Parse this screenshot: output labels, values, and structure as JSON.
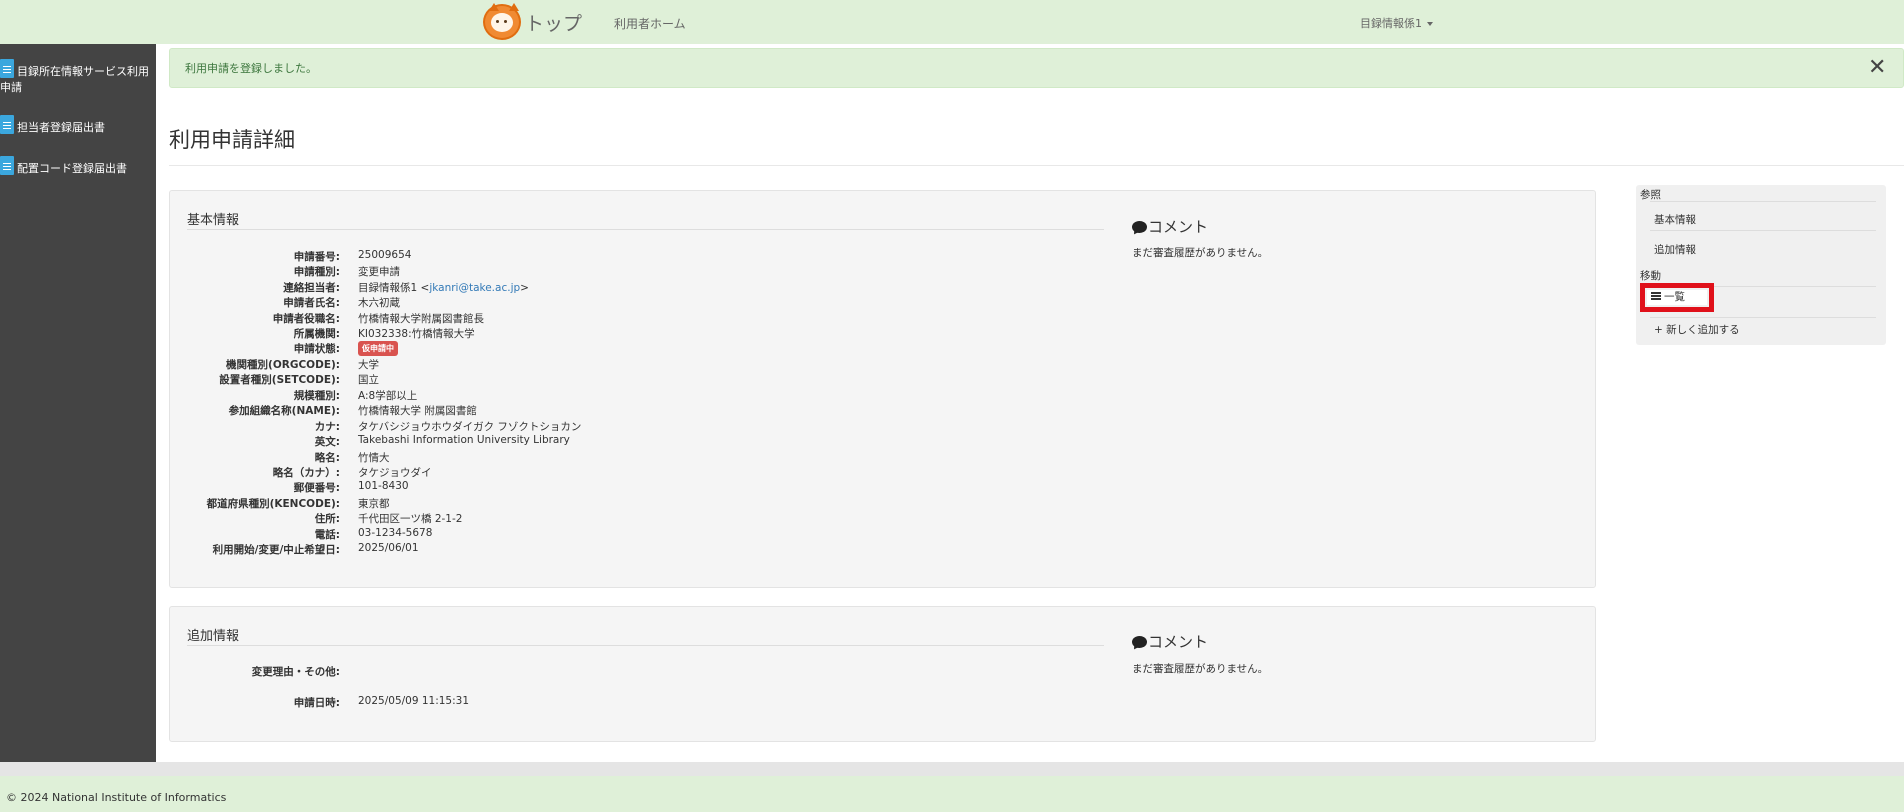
{
  "header": {
    "brand": "トップ",
    "home_link": "利用者ホーム",
    "user_menu": "目録情報係1"
  },
  "sidebar": {
    "items": [
      {
        "label": "目録所在情報サービス利用申請"
      },
      {
        "label": "担当者登録届出書"
      },
      {
        "label": "配置コード登録届出書"
      }
    ]
  },
  "alert": {
    "message": "利用申請を登録しました。",
    "close": "✕"
  },
  "page": {
    "title": "利用申請詳細"
  },
  "basic": {
    "heading": "基本情報",
    "fields": [
      {
        "label": "申請番号:",
        "value": "25009654"
      },
      {
        "label": "申請種別:",
        "value": "変更申請"
      },
      {
        "label": "連絡担当者:",
        "value": "目録情報係1 <",
        "link": "jkanri@take.ac.jp",
        "suffix": ">"
      },
      {
        "label": "申請者氏名:",
        "value": "木六初蔵"
      },
      {
        "label": "申請者役職名:",
        "value": "竹橋情報大学附属図書館長"
      },
      {
        "label": "所属機関:",
        "value": "KI032338:竹橋情報大学"
      },
      {
        "label": "申請状態:",
        "badge": "仮申請中"
      },
      {
        "label": "機関種別(ORGCODE):",
        "value": "大学"
      },
      {
        "label": "設置者種別(SETCODE):",
        "value": "国立"
      },
      {
        "label": "規模種別:",
        "value": "A:8学部以上"
      },
      {
        "label": "参加組織名称(NAME):",
        "value": "竹橋情報大学 附属図書館"
      },
      {
        "label": "カナ:",
        "value": "タケバシジョウホウダイガク フゾクトショカン"
      },
      {
        "label": "英文:",
        "value": "Takebashi Information University Library"
      },
      {
        "label": "略名:",
        "value": "竹情大"
      },
      {
        "label": "略名（カナ）:",
        "value": "タケジョウダイ"
      },
      {
        "label": "郵便番号:",
        "value": "101-8430"
      },
      {
        "label": "都道府県種別(KENCODE):",
        "value": "東京都"
      },
      {
        "label": "住所:",
        "value": "千代田区一ツ橋 2-1-2"
      },
      {
        "label": "電話:",
        "value": "03-1234-5678"
      },
      {
        "label": "利用開始/変更/中止希望日:",
        "value": "2025/06/01"
      }
    ],
    "comment_heading": "コメント",
    "comment_text": "まだ審査履歴がありません。"
  },
  "additional": {
    "heading": "追加情報",
    "fields": [
      {
        "label": "変更理由・その他:",
        "value": ""
      },
      {
        "label": "申請日時:",
        "value": "2025/05/09 11:15:31"
      }
    ],
    "comment_heading": "コメント",
    "comment_text": "まだ審査履歴がありません。"
  },
  "right_nav": {
    "ref_label": "参照",
    "ref_items": [
      "基本情報",
      "追加情報"
    ],
    "move_label": "移動",
    "list_label": "一覧",
    "add_label": "新しく追加する"
  },
  "footer": {
    "text": "© 2024 National Institute of Informatics"
  }
}
